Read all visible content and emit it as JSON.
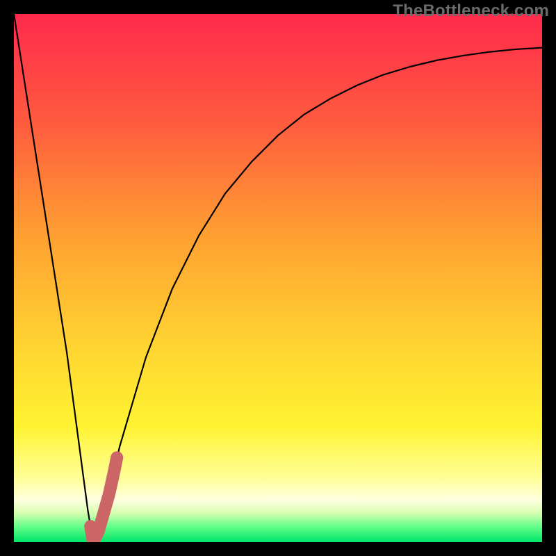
{
  "watermark": "TheBottleneck.com",
  "gradient_stops": [
    {
      "offset": 0.0,
      "color": "#ff2a4c"
    },
    {
      "offset": 0.2,
      "color": "#ff593f"
    },
    {
      "offset": 0.42,
      "color": "#ffa031"
    },
    {
      "offset": 0.62,
      "color": "#ffd231"
    },
    {
      "offset": 0.78,
      "color": "#fff331"
    },
    {
      "offset": 0.88,
      "color": "#ffff99"
    },
    {
      "offset": 0.92,
      "color": "#ffffe0"
    },
    {
      "offset": 0.945,
      "color": "#d7ffb0"
    },
    {
      "offset": 0.97,
      "color": "#66ff8a"
    },
    {
      "offset": 1.0,
      "color": "#00e56a"
    }
  ],
  "chart_data": {
    "type": "line",
    "title": "",
    "xlabel": "",
    "ylabel": "",
    "xlim": [
      0,
      100
    ],
    "ylim": [
      0,
      100
    ],
    "series": [
      {
        "name": "bottleneck-curve",
        "x": [
          0,
          5,
          10,
          14,
          15,
          16,
          18,
          20,
          25,
          30,
          35,
          40,
          45,
          50,
          55,
          60,
          65,
          70,
          75,
          80,
          85,
          90,
          95,
          100
        ],
        "y": [
          100,
          68,
          36,
          6,
          0,
          2,
          9,
          18,
          35,
          48,
          58,
          66,
          72,
          77,
          81,
          84,
          86.5,
          88.5,
          90,
          91.2,
          92.1,
          92.8,
          93.3,
          93.6
        ],
        "stroke": "#000000",
        "stroke_width": 2.2
      },
      {
        "name": "highlight-segment",
        "x": [
          14.5,
          15.0,
          16.0,
          17.0,
          18.0,
          19.0,
          19.5
        ],
        "y": [
          3.0,
          0.0,
          2.0,
          5.5,
          9.0,
          13.5,
          16.0
        ],
        "stroke": "#cc6666",
        "stroke_width": 18,
        "linecap": "round"
      }
    ]
  }
}
